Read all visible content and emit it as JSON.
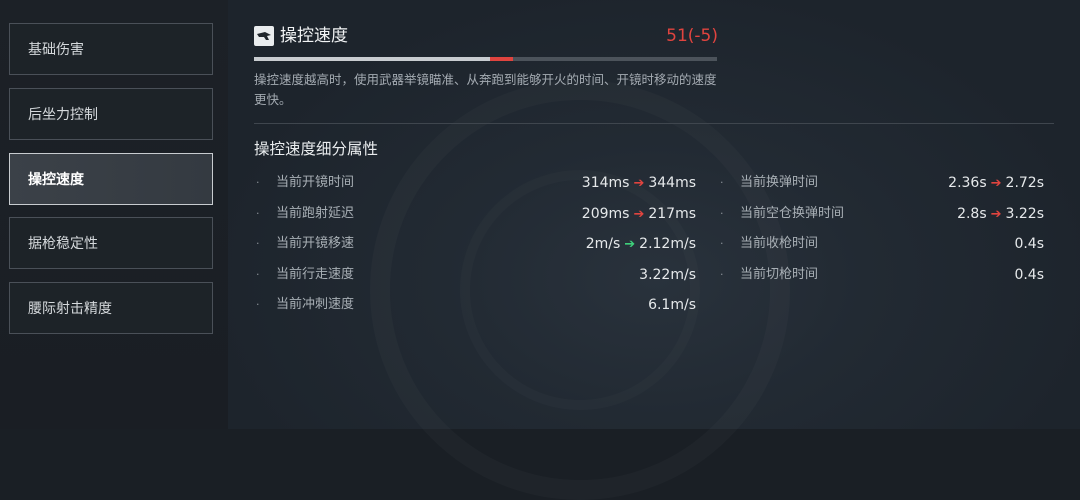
{
  "nav": {
    "items": [
      {
        "label": "基础伤害"
      },
      {
        "label": "后坐力控制"
      },
      {
        "label": "操控速度"
      },
      {
        "label": "据枪稳定性"
      },
      {
        "label": "腰际射击精度"
      }
    ]
  },
  "stat": {
    "icon": "weapon-handling-icon",
    "title": "操控速度",
    "value": "51(-5)",
    "value_color": "#e0443f",
    "bar_current_fraction": 0.51,
    "bar_previous_fraction": 0.56,
    "description": "操控速度越高时，使用武器举镜瞄准、从奔跑到能够开火的时间、开镜时移动的速度更快。"
  },
  "details": {
    "title": "操控速度细分属性",
    "left": [
      {
        "label": "当前开镜时间",
        "old": "314ms",
        "arrow": "red",
        "new": "344ms"
      },
      {
        "label": "当前跑射延迟",
        "old": "209ms",
        "arrow": "red",
        "new": "217ms"
      },
      {
        "label": "当前开镜移速",
        "old": "2m/s",
        "arrow": "green",
        "new": "2.12m/s"
      },
      {
        "label": "当前行走速度",
        "old": "",
        "arrow": "",
        "new": "3.22m/s"
      },
      {
        "label": "当前冲刺速度",
        "old": "",
        "arrow": "",
        "new": "6.1m/s"
      }
    ],
    "right": [
      {
        "label": "当前换弹时间",
        "old": "2.36s",
        "arrow": "red",
        "new": "2.72s"
      },
      {
        "label": "当前空仓换弹时间",
        "old": "2.8s",
        "arrow": "red",
        "new": "3.22s"
      },
      {
        "label": "当前收枪时间",
        "old": "",
        "arrow": "",
        "new": "0.4s"
      },
      {
        "label": "当前切枪时间",
        "old": "",
        "arrow": "",
        "new": "0.4s"
      }
    ],
    "arrow_glyph": "➔",
    "bullet_glyph": "·"
  }
}
